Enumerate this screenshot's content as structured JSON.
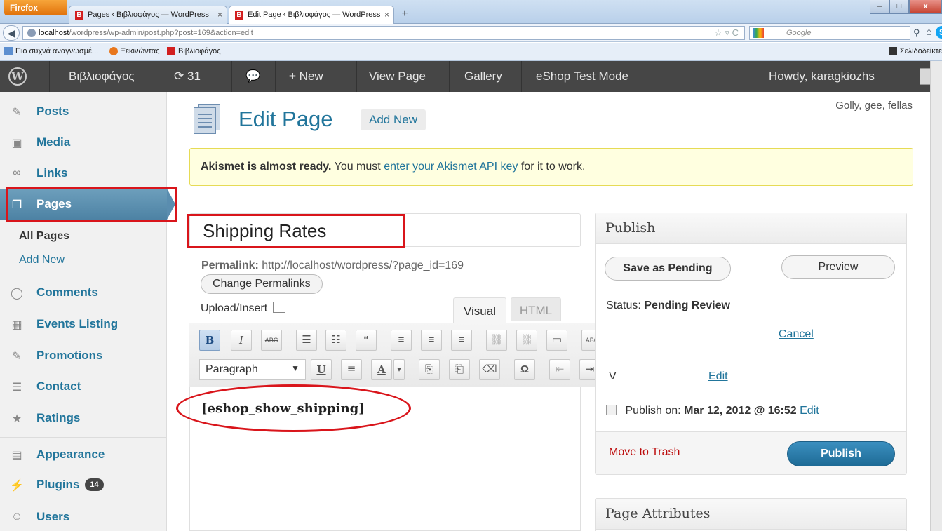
{
  "browser": {
    "menu_button": "Firefox",
    "tabs": [
      {
        "title": "Pages ‹ Βιβλιοφάγος — WordPress",
        "favicon": "B"
      },
      {
        "title": "Edit Page ‹ Βιβλιοφάγος — WordPress",
        "favicon": "B"
      }
    ],
    "new_tab": "+",
    "window_controls": {
      "minimize": "–",
      "maximize": "□",
      "close": "x"
    },
    "url": {
      "host": "localhost",
      "path": "/wordpress/wp-admin/post.php?post=169&action=edit"
    },
    "search_placeholder": "Google",
    "bookmarks": [
      "Πιο συχνά αναγνωσμέ...",
      "Ξεκινώντας",
      "Βιβλιοφάγος"
    ],
    "bookmarks_menu": "Σελιδοδείκτε"
  },
  "admin_bar": {
    "site_name": "Βιβλιοφάγος",
    "updates": "31",
    "new_label": "New",
    "view_page": "View Page",
    "gallery": "Gallery",
    "eshop_mode": "eShop Test Mode",
    "howdy": "Howdy, karagkiozhs"
  },
  "menu": {
    "items": [
      {
        "label": "Posts",
        "icon": "pin-icon"
      },
      {
        "label": "Media",
        "icon": "media-icon"
      },
      {
        "label": "Links",
        "icon": "link-icon"
      },
      {
        "label": "Pages",
        "icon": "pages-icon"
      },
      {
        "label": "Comments",
        "icon": "comment-icon"
      },
      {
        "label": "Events Listing",
        "icon": "calendar-icon"
      },
      {
        "label": "Promotions",
        "icon": "pin-icon"
      },
      {
        "label": "Contact",
        "icon": "contact-icon"
      },
      {
        "label": "Ratings",
        "icon": "star-icon"
      },
      {
        "label": "Appearance",
        "icon": "appearance-icon"
      },
      {
        "label": "Plugins",
        "icon": "plug-icon",
        "badge": "14"
      },
      {
        "label": "Users",
        "icon": "users-icon"
      }
    ],
    "pages_submenu": [
      "All Pages",
      "Add New"
    ]
  },
  "header": {
    "title": "Edit Page",
    "add_new": "Add New",
    "tagline": "Golly, gee, fellas"
  },
  "notice": {
    "bold": "Akismet is almost ready.",
    "text1": "You must",
    "link": "enter your Akismet API key",
    "text2": "for it to work."
  },
  "editor": {
    "title_value": "Shipping Rates",
    "permalink_label": "Permalink:",
    "permalink_url": "http://localhost/wordpress/?page_id=169",
    "change_permalinks": "Change Permalinks",
    "upload_insert": "Upload/Insert",
    "tab_visual": "Visual",
    "tab_html": "HTML",
    "format_select": "Paragraph",
    "content": "[eshop_show_shipping]",
    "toolbar_row1": [
      "B",
      "I",
      "ABC",
      "☰",
      "☷",
      "“",
      "≡",
      "≡",
      "≡",
      "⛓",
      "⛓",
      "▭",
      "ABC",
      "▾",
      "⛶",
      "⊞"
    ],
    "toolbar_row2": [
      "U",
      "≣",
      "A",
      "▾",
      "⎘",
      "⎗",
      "⌫",
      "Ω",
      "⇤",
      "⇥",
      "↶",
      "↷",
      "?"
    ]
  },
  "publish": {
    "title": "Publish",
    "save_pending": "Save as Pending",
    "preview": "Preview",
    "status_label": "Status:",
    "status_value": "Pending Review",
    "cancel": "Cancel",
    "visibility_text": "V",
    "visibility_edit": "Edit",
    "publish_on_label": "Publish on:",
    "publish_on_value": "Mar 12, 2012 @ 16:52",
    "publish_on_edit": "Edit",
    "move_to_trash": "Move to Trash",
    "publish_button": "Publish"
  },
  "page_attributes": {
    "title": "Page Attributes"
  },
  "colors": {
    "link": "#21759b",
    "admin_bar": "#464646",
    "highlight": "#d9151b",
    "publish": "#1e6b96"
  }
}
